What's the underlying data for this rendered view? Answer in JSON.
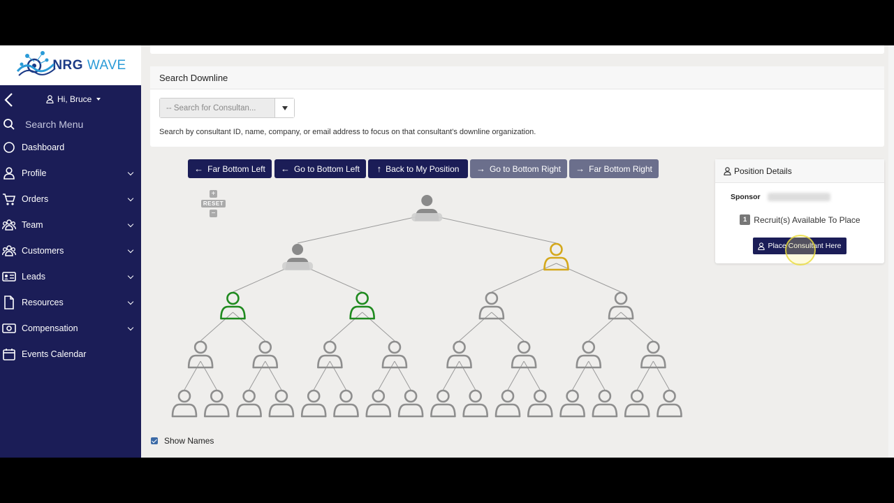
{
  "brand": {
    "name_left": "NRG",
    "name_right": "WAVE"
  },
  "sidebar": {
    "greeting": "Hi, Bruce",
    "search_label": "Search Menu",
    "items": [
      {
        "label": "Dashboard",
        "icon": "circle-icon",
        "has_children": false
      },
      {
        "label": "Profile",
        "icon": "user-icon",
        "has_children": true
      },
      {
        "label": "Orders",
        "icon": "cart-icon",
        "has_children": true
      },
      {
        "label": "Team",
        "icon": "team-icon",
        "has_children": true
      },
      {
        "label": "Customers",
        "icon": "customers-icon",
        "has_children": true
      },
      {
        "label": "Leads",
        "icon": "id-card-icon",
        "has_children": true
      },
      {
        "label": "Resources",
        "icon": "document-icon",
        "has_children": true
      },
      {
        "label": "Compensation",
        "icon": "money-icon",
        "has_children": true
      },
      {
        "label": "Events Calendar",
        "icon": "calendar-icon",
        "has_children": false
      }
    ]
  },
  "search": {
    "title": "Search Downline",
    "placeholder": "-- Search for Consultan...",
    "help": "Search by consultant ID, name, company, or email address to focus on that consultant's downline organization."
  },
  "nav_buttons": [
    {
      "label": "Far Bottom Left",
      "arrow": "←",
      "style": "dark"
    },
    {
      "label": "Go to Bottom Left",
      "arrow": "←",
      "style": "dark"
    },
    {
      "label": "Back to My Position",
      "arrow": "↑",
      "style": "dark"
    },
    {
      "label": "Go to Bottom Right",
      "arrow": "→",
      "style": "gray"
    },
    {
      "label": "Far Bottom Right",
      "arrow": "→",
      "style": "gray"
    }
  ],
  "zoom": {
    "plus": "+",
    "reset": "RESET",
    "minus": "−"
  },
  "tree": {
    "levels": [
      [
        "filled"
      ],
      [
        "filled",
        "open"
      ],
      [
        "active",
        "active",
        "empty",
        "empty"
      ],
      [
        "empty",
        "empty",
        "empty",
        "empty",
        "empty",
        "empty",
        "empty",
        "empty"
      ],
      [
        "empty",
        "empty",
        "empty",
        "empty",
        "empty",
        "empty",
        "empty",
        "empty",
        "empty",
        "empty",
        "empty",
        "empty",
        "empty",
        "empty",
        "empty",
        "empty"
      ]
    ],
    "colors": {
      "filled": "#8a8a8a",
      "open": "#d4a81c",
      "active": "#1f8a1f",
      "empty": "#8e8e8e",
      "line": "#9a9a9a"
    }
  },
  "position_details": {
    "title": "Position Details",
    "sponsor_label": "Sponsor",
    "recruits_count": "1",
    "recruits_label": "Recruit(s) Available To Place",
    "place_button": "Place Consultant Here"
  },
  "show_names": {
    "label": "Show Names",
    "checked": true
  },
  "colors": {
    "sidebar": "#1b1d57",
    "accent": "#2a9bd7",
    "gray_button": "#6b6f8c"
  }
}
